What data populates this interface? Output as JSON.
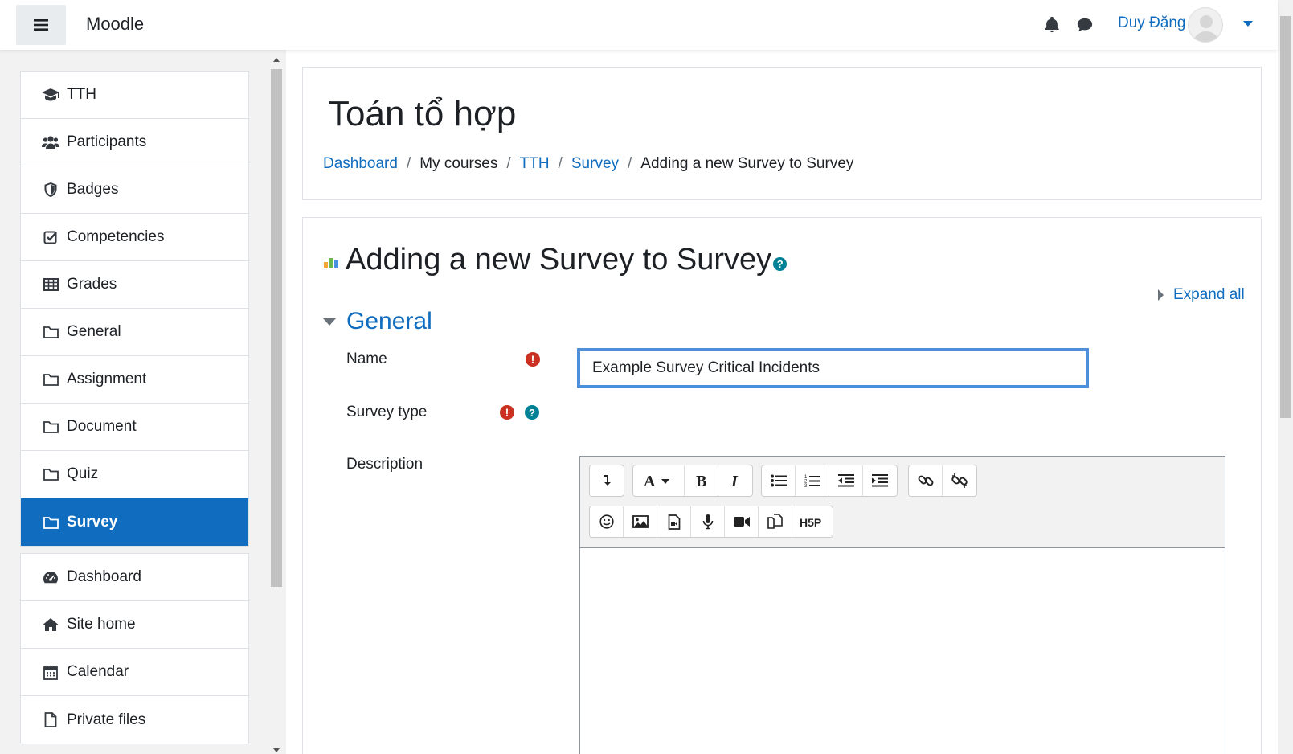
{
  "app": {
    "brand": "Moodle"
  },
  "user": {
    "name": "Duy Đặng"
  },
  "drawer": {
    "items": [
      {
        "label": "TTH",
        "icon": "graduation-cap-icon"
      },
      {
        "label": "Participants",
        "icon": "users-icon"
      },
      {
        "label": "Badges",
        "icon": "shield-icon"
      },
      {
        "label": "Competencies",
        "icon": "check-square-icon"
      },
      {
        "label": "Grades",
        "icon": "table-icon"
      },
      {
        "label": "General",
        "icon": "folder-icon"
      },
      {
        "label": "Assignment",
        "icon": "folder-icon"
      },
      {
        "label": "Document",
        "icon": "folder-icon"
      },
      {
        "label": "Quiz",
        "icon": "folder-icon"
      },
      {
        "label": "Survey",
        "icon": "folder-icon",
        "active": true
      }
    ],
    "items2": [
      {
        "label": "Dashboard",
        "icon": "tachometer-icon"
      },
      {
        "label": "Site home",
        "icon": "home-icon"
      },
      {
        "label": "Calendar",
        "icon": "calendar-icon"
      },
      {
        "label": "Private files",
        "icon": "file-icon"
      }
    ]
  },
  "header": {
    "course_title": "Toán tổ hợp",
    "breadcrumb": {
      "dashboard": "Dashboard",
      "my_courses": "My courses",
      "course": "TTH",
      "section": "Survey",
      "current": "Adding a new Survey to Survey"
    }
  },
  "form": {
    "title": "Adding a new Survey to Survey",
    "expand_all": "Expand all",
    "section_general": "General",
    "name_label": "Name",
    "name_value": "Example Survey Critical Incidents",
    "survey_type_label": "Survey type",
    "description_label": "Description"
  },
  "colors": {
    "accent": "#0f6cbf",
    "required": "#ca3120",
    "help": "#008196"
  }
}
